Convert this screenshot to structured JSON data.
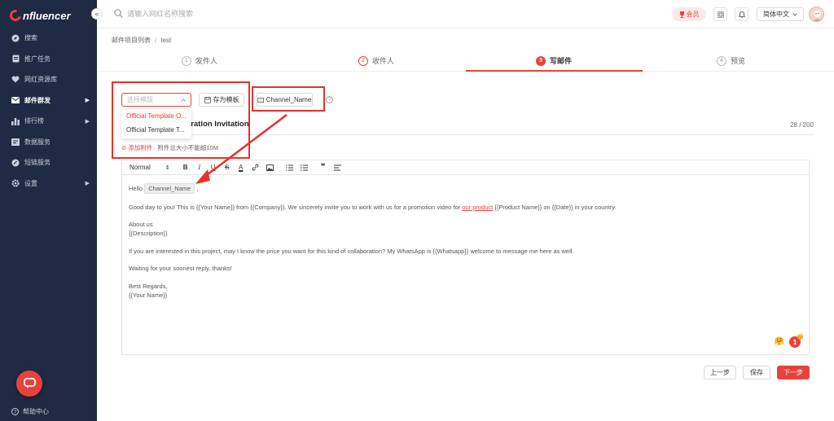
{
  "app": {
    "logo_text": "nfluencer",
    "collapse_glyph": "«"
  },
  "sidebar": {
    "items": [
      {
        "label": "搜索",
        "icon": "compass-icon",
        "arrow": ""
      },
      {
        "label": "推广任务",
        "icon": "document-icon",
        "arrow": ""
      },
      {
        "label": "网红资源库",
        "icon": "heart-icon",
        "arrow": ""
      },
      {
        "label": "邮件群发",
        "icon": "mail-icon",
        "arrow": "▶",
        "active": true
      },
      {
        "label": "排行榜",
        "icon": "bar-chart-icon",
        "arrow": "▶"
      },
      {
        "label": "数据服务",
        "icon": "data-icon",
        "arrow": ""
      },
      {
        "label": "短链服务",
        "icon": "link-icon",
        "arrow": ""
      },
      {
        "label": "设置",
        "icon": "gear-icon",
        "arrow": "▶"
      }
    ],
    "help_label": "帮助中心"
  },
  "topbar": {
    "search_placeholder": "请输入网红名称搜索",
    "vip_label": "会员",
    "language": "简体中文"
  },
  "breadcrumb": {
    "parent": "邮件项目列表",
    "current": "test"
  },
  "steps": [
    {
      "num": "1",
      "label": "发件人"
    },
    {
      "num": "2",
      "label": "收件人"
    },
    {
      "num": "3",
      "label": "写邮件"
    },
    {
      "num": "4",
      "label": "预览"
    }
  ],
  "composer": {
    "template_placeholder": "选择模版",
    "save_template_label": "存为模板",
    "channel_name_button": "Channel_Name",
    "help_glyph": "?",
    "dropdown_options": [
      "Official Template O...",
      "Official Template T..."
    ],
    "subject_visible": "eration Invitation",
    "char_count": "28 / 200",
    "attach_link": "添加附件",
    "attach_hint": "附件总大小不能超10M"
  },
  "editor": {
    "format_select": "Normal",
    "greeting_prefix": "Hello",
    "channel_chip": "Channel_Name",
    "greeting_suffix": ",",
    "p1_before": "Good day to you! This is {{Your Name}} from {{Company}}. We sincerely invite you to work with us for a promotion video for",
    "p1_underlined": "our  product",
    "p1_after": "{{Product Name}} on {{Date}} in your country.",
    "p2_line1": "About us",
    "p2_line2": "{{Description}}",
    "p3": "If you are interested in this project, may I know the price you want for this kind of collaboration? My WhatsApp is {{Whatsapp}} welcome to message me here as well.",
    "p4": "Waiting for your soonest reply, thanks!",
    "p5_line1": "Best Regards,",
    "p5_line2": "{{Your Name}}",
    "emoji": "🤗",
    "badge_count": "1",
    "badge_plus": "+"
  },
  "actions": {
    "prev": "上一步",
    "save": "保存",
    "next": "下一步"
  },
  "colors": {
    "accent": "#e8433b",
    "sidebar_bg": "#1f2a44",
    "annotation": "#e8312a"
  }
}
